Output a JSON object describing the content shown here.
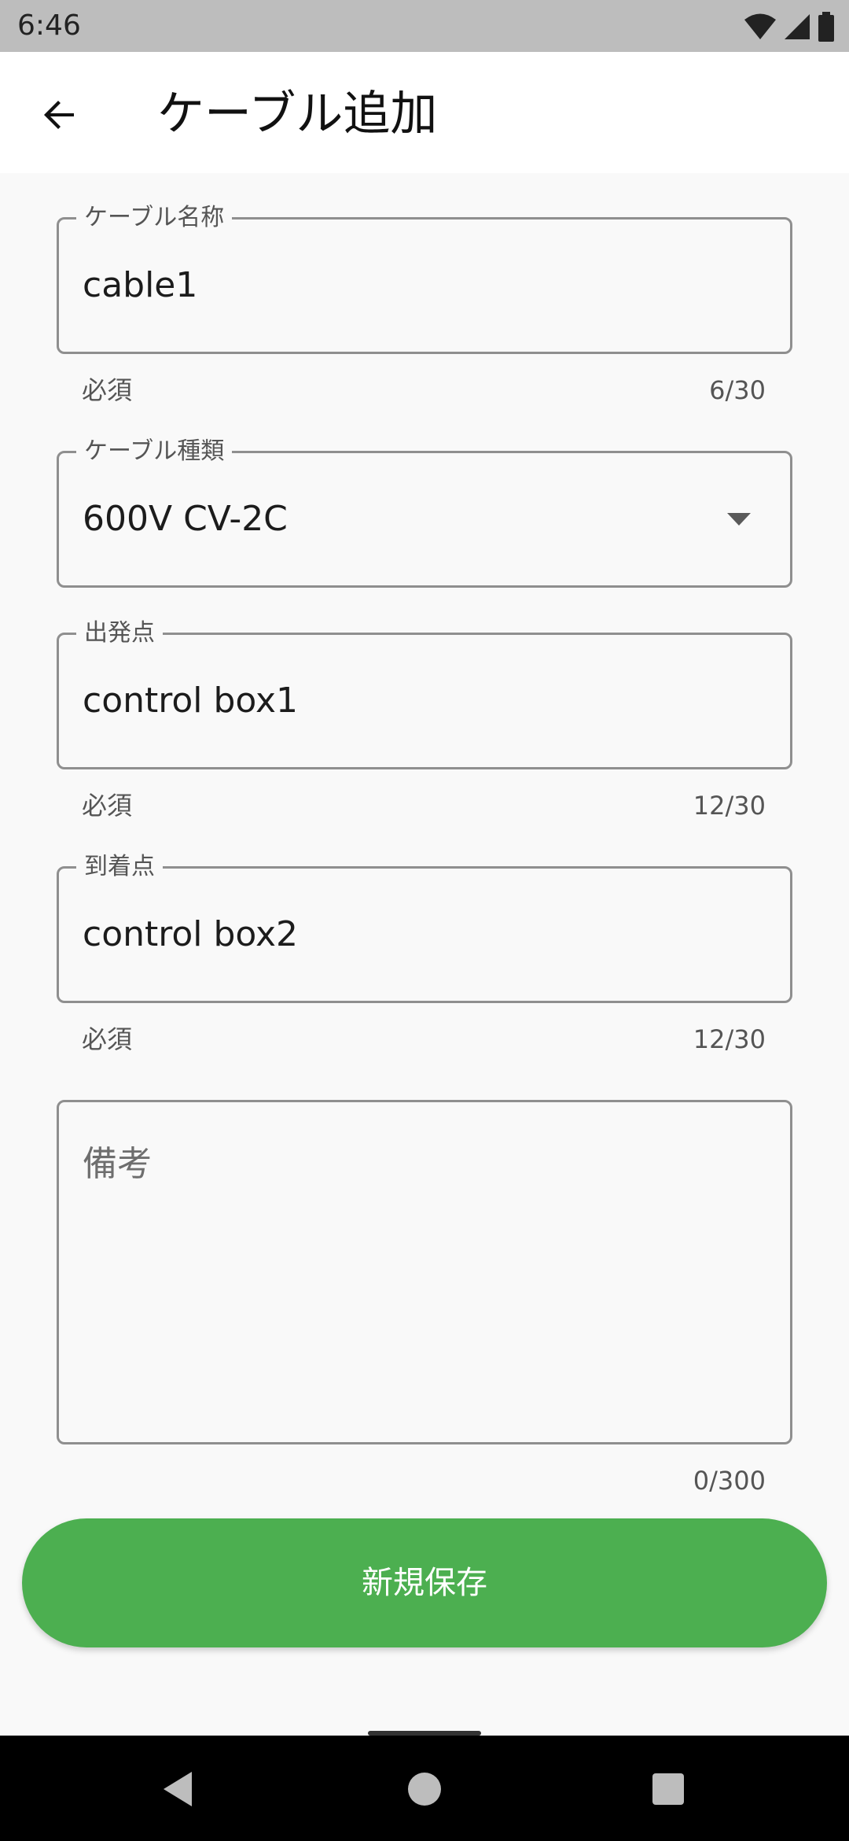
{
  "status_bar": {
    "time": "6:46",
    "icons": [
      "wifi-icon",
      "signal-icon",
      "battery-icon"
    ]
  },
  "app_bar": {
    "title": "ケーブル追加",
    "back_icon": "arrow-back-icon"
  },
  "form": {
    "cable_name": {
      "label": "ケーブル名称",
      "value": "cable1",
      "helper": "必須",
      "counter": "6/30"
    },
    "cable_type": {
      "label": "ケーブル種類",
      "value": "600V CV-2C",
      "icon": "dropdown-arrow-icon"
    },
    "origin": {
      "label": "出発点",
      "value": "control box1",
      "helper": "必須",
      "counter": "12/30"
    },
    "destination": {
      "label": "到着点",
      "value": "control box2",
      "helper": "必須",
      "counter": "12/30"
    },
    "remarks": {
      "placeholder": "備考",
      "value": "",
      "counter": "0/300"
    }
  },
  "save_button": {
    "label": "新規保存",
    "color": "#4caf50"
  },
  "nav_bar": {
    "icons": [
      "back-triangle-icon",
      "home-circle-icon",
      "recents-square-icon"
    ]
  }
}
